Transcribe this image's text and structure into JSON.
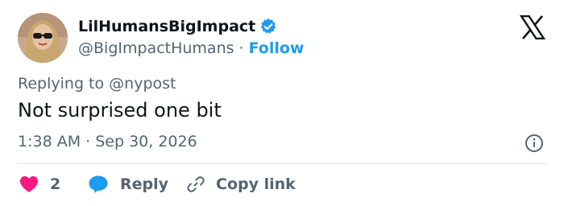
{
  "author": {
    "display_name": "LilHumansBigImpact",
    "handle": "@BigImpactHumans",
    "separator": "·",
    "follow_label": "Follow",
    "verified": true
  },
  "tweet": {
    "reply_context": "Replying to @nypost",
    "text": "Not surprised one bit",
    "timestamp": "1:38 AM · Sep 30, 2026"
  },
  "actions": {
    "like_count": "2",
    "reply_label": "Reply",
    "copy_link_label": "Copy link"
  },
  "icons": {
    "logo": "x-logo-icon",
    "verified": "verified-badge-icon",
    "info": "info-icon",
    "like": "heart-icon",
    "reply": "speech-bubble-icon",
    "copy_link": "link-icon"
  },
  "colors": {
    "text_primary": "#0f1419",
    "text_secondary": "#536471",
    "accent": "#1d9bf0",
    "like": "#f91880",
    "divider": "#e1e8ed"
  }
}
